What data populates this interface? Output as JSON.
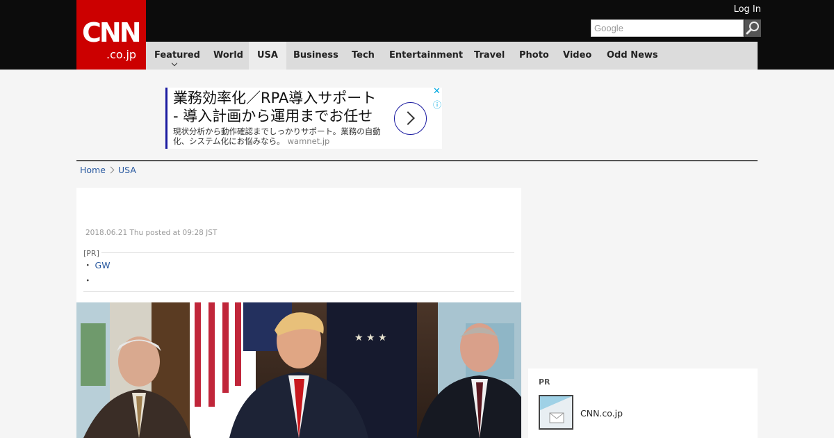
{
  "header": {
    "logo_main": "CNN",
    "logo_sub": ".co.jp",
    "login_label": "Log In",
    "search_placeholder": "Google",
    "search_icon": "magnifier-icon"
  },
  "nav": {
    "items": [
      {
        "label": "Featured"
      },
      {
        "label": "World"
      },
      {
        "label": "USA"
      },
      {
        "label": "Business"
      },
      {
        "label": "Tech"
      },
      {
        "label": "Entertainment"
      },
      {
        "label": "Travel"
      },
      {
        "label": "Photo"
      },
      {
        "label": "Video"
      },
      {
        "label": "Odd News"
      }
    ],
    "active": "USA"
  },
  "ad": {
    "headline1": "業務効率化／RPA導入サポート",
    "headline2": "- 導入計画から運用までお任せ",
    "description": "現状分析から動作確認までしっかりサポート。業務の自動化、システム化にお悩みなら。",
    "domain": "wamnet.jp",
    "close_icon": "✕",
    "info_icon": "ⓘ"
  },
  "breadcrumb": {
    "home": "Home",
    "current": "USA"
  },
  "article": {
    "posted": "2018.06.21 Thu posted at 09:28 JST",
    "pr_label": "[PR]",
    "pr_items": [
      {
        "bullet": "・",
        "text": "GW"
      },
      {
        "bullet": "・",
        "text": ""
      }
    ]
  },
  "sidebar": {
    "pr_label": "PR",
    "item_name": "CNN.co.jp"
  },
  "colors": {
    "brand_red": "#cc0000",
    "top_bar": "#0c0c0c",
    "nav_bg": "#dcdcdc",
    "link": "#2a5aa0"
  }
}
